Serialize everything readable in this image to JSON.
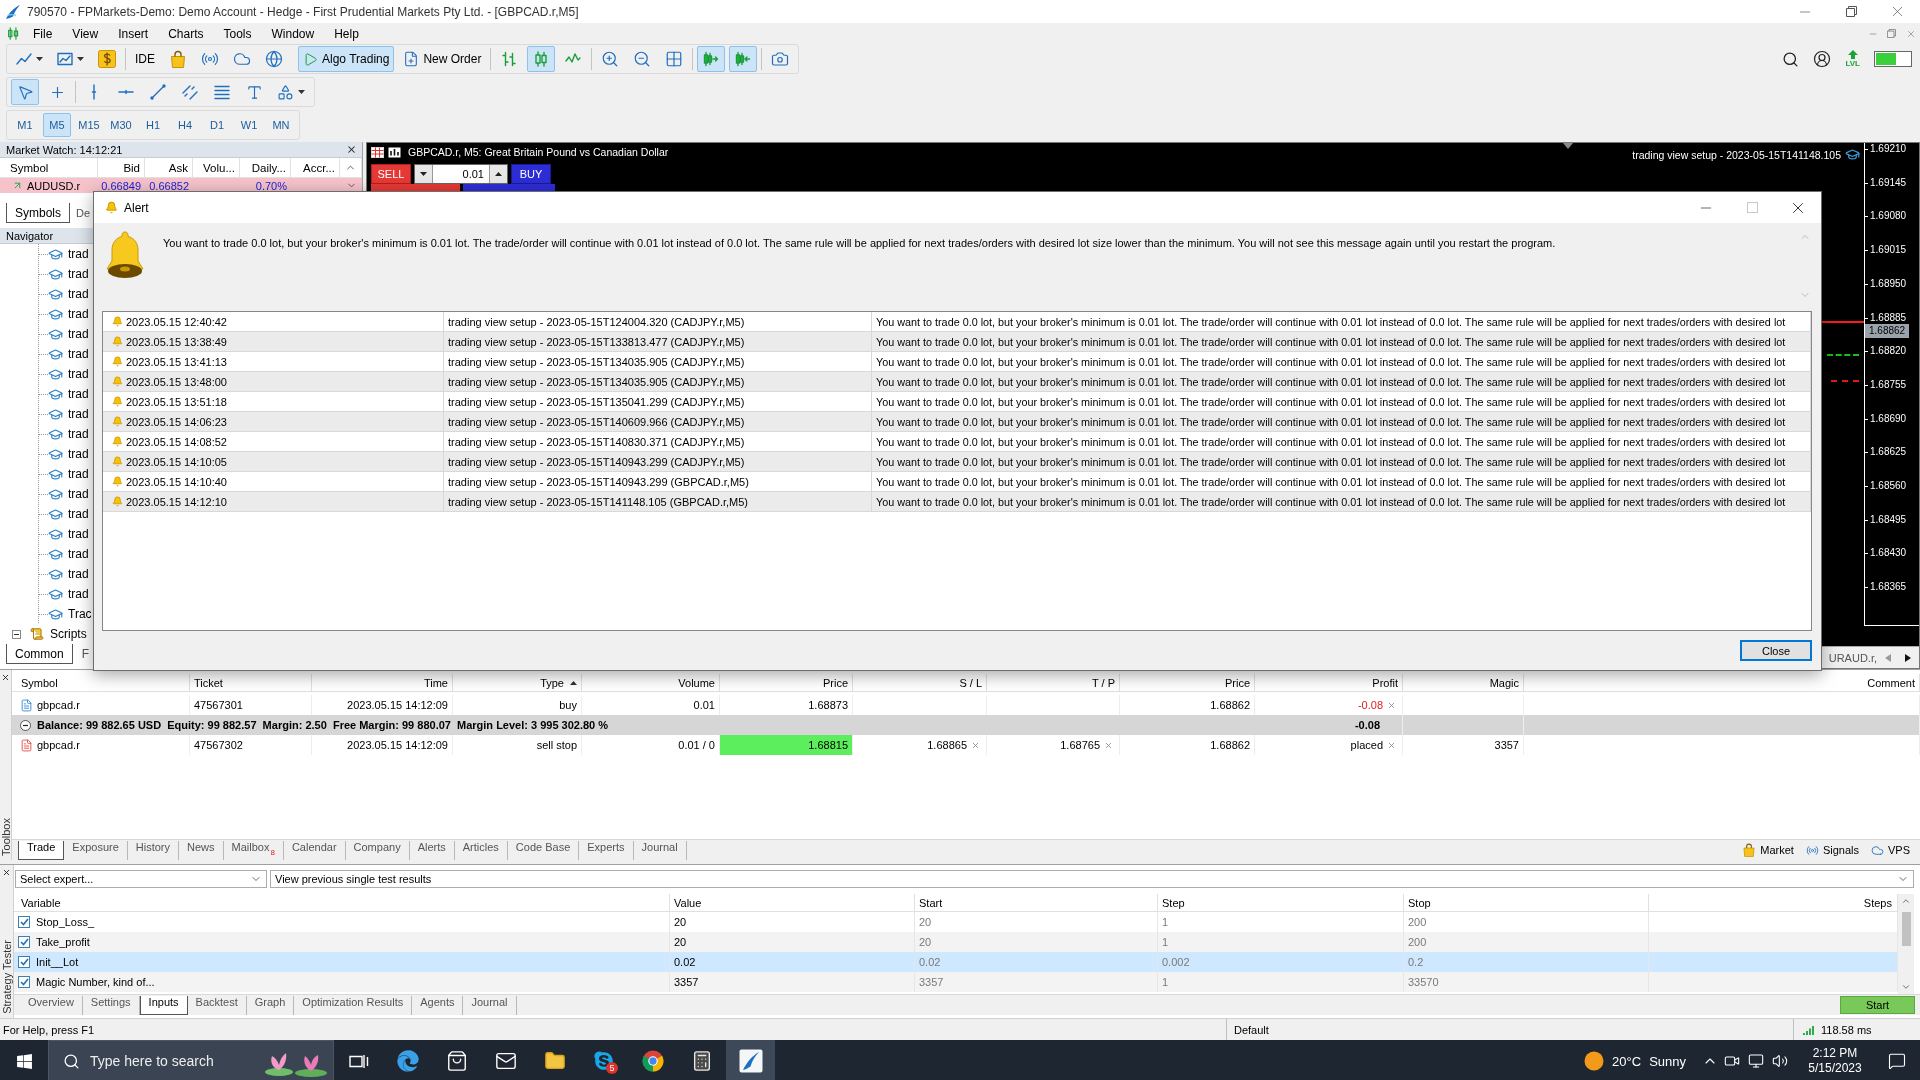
{
  "window": {
    "title": "790570 - FPMarkets-Demo: Demo Account - Hedge - First Prudential Markets Pty Ltd. - [GBPCAD.r,M5]"
  },
  "menu": [
    "File",
    "View",
    "Insert",
    "Charts",
    "Tools",
    "Window",
    "Help"
  ],
  "toolbar": [
    [
      {
        "on": false
      },
      {
        "on": false
      },
      {
        "on": false
      }
    ],
    [
      {
        "label": "IDE",
        "on": false
      },
      {
        "on": false
      },
      {
        "on": false
      },
      {
        "on": false
      },
      {
        "on": false
      }
    ],
    [
      {
        "label": "Algo Trading",
        "on": true
      },
      {
        "label": "New Order",
        "on": false
      }
    ],
    [
      {
        "on": false
      },
      {
        "on": true
      },
      {
        "on": false
      }
    ],
    [
      {
        "on": false
      },
      {
        "on": false
      },
      {
        "on": false
      }
    ],
    [
      {
        "on": true
      },
      {
        "on": true
      }
    ],
    [
      {
        "on": false
      }
    ]
  ],
  "status_badge": "LVL",
  "drawing_tools": [
    [
      {
        "on": true
      },
      {
        "on": false
      }
    ],
    [
      {
        "on": false
      },
      {
        "on": false
      },
      {
        "on": false
      },
      {
        "on": false
      },
      {
        "on": false
      },
      {
        "on": false
      },
      {
        "on": false
      }
    ]
  ],
  "timeframes": [
    {
      "label": "M1",
      "selected": false
    },
    {
      "label": "M5",
      "selected": true
    },
    {
      "label": "M15",
      "selected": false
    },
    {
      "label": "M30",
      "selected": false
    },
    {
      "label": "H1",
      "selected": false
    },
    {
      "label": "H4",
      "selected": false
    },
    {
      "label": "D1",
      "selected": false
    },
    {
      "label": "W1",
      "selected": false
    },
    {
      "label": "MN",
      "selected": false
    }
  ],
  "market_watch": {
    "title": "Market Watch: 14:12:21",
    "columns": [
      "Symbol",
      "Bid",
      "Ask",
      "Volu...",
      "Daily...",
      "Accr..."
    ],
    "rows": [
      {
        "symbol": "AUDUSD.r",
        "bid": "0.66849",
        "ask": "0.66852",
        "daily": "0.70%"
      }
    ],
    "tabs": [
      {
        "label": "Symbols",
        "selected": true
      },
      {
        "label": "De",
        "selected": false
      }
    ]
  },
  "navigator": {
    "title": "Navigator",
    "experts": [
      {
        "label": "trad"
      },
      {
        "label": "trad"
      },
      {
        "label": "trad"
      },
      {
        "label": "trad"
      },
      {
        "label": "trad"
      },
      {
        "label": "trad"
      },
      {
        "label": "trad"
      },
      {
        "label": "trad"
      },
      {
        "label": "trad"
      },
      {
        "label": "trad"
      },
      {
        "label": "trad"
      },
      {
        "label": "trad"
      },
      {
        "label": "trad"
      },
      {
        "label": "trad"
      },
      {
        "label": "trad"
      },
      {
        "label": "trad"
      },
      {
        "label": "trad"
      },
      {
        "label": "trad"
      },
      {
        "label": "Trac"
      }
    ],
    "folders": [
      {
        "label": "Scripts",
        "expanded": true
      }
    ],
    "tabs": [
      {
        "label": "Common",
        "selected": true
      },
      {
        "label": "F",
        "selected": false
      }
    ]
  },
  "chart": {
    "title": "GBPCAD.r, M5: Great Britain Pound vs Canadian Dollar",
    "sell": "SELL",
    "lot": "0.01",
    "buy": "BUY",
    "expert": "trading view setup - 2023-05-15T141148.105",
    "price_axis": [
      "1.69210",
      "1.69145",
      "1.69080",
      "1.69015",
      "1.68950",
      "1.68885",
      "1.68820",
      "1.68755",
      "1.68690",
      "1.68625",
      "1.68560",
      "1.68495",
      "1.68430",
      "1.68365"
    ],
    "current_price": "1.68862",
    "tab": "URAUD.r,"
  },
  "alert": {
    "title": "Alert",
    "message": "You want to trade 0.0 lot, but your broker's minimum is 0.01 lot. The trade/order will continue with 0.01 lot instead of 0.0 lot. The same rule will be applied for next trades/orders with desired lot size lower than the minimum. You will not see this message again until you restart the program.",
    "rows": [
      {
        "time": "2023.05.15 12:40:42",
        "source": "trading view setup - 2023-05-15T124004.320 (CADJPY.r,M5)",
        "message": "You want to trade 0.0 lot, but your broker's minimum is 0.01 lot. The trade/order will continue with 0.01 lot instead of 0.0 lot. The same rule will be applied for next trades/orders with desired lot"
      },
      {
        "time": "2023.05.15 13:38:49",
        "source": "trading view setup - 2023-05-15T133813.477 (CADJPY.r,M5)",
        "message": "You want to trade 0.0 lot, but your broker's minimum is 0.01 lot. The trade/order will continue with 0.01 lot instead of 0.0 lot. The same rule will be applied for next trades/orders with desired lot"
      },
      {
        "time": "2023.05.15 13:41:13",
        "source": "trading view setup - 2023-05-15T134035.905 (CADJPY.r,M5)",
        "message": "You want to trade 0.0 lot, but your broker's minimum is 0.01 lot. The trade/order will continue with 0.01 lot instead of 0.0 lot. The same rule will be applied for next trades/orders with desired lot"
      },
      {
        "time": "2023.05.15 13:48:00",
        "source": "trading view setup - 2023-05-15T134035.905 (CADJPY.r,M5)",
        "message": "You want to trade 0.0 lot, but your broker's minimum is 0.01 lot. The trade/order will continue with 0.01 lot instead of 0.0 lot. The same rule will be applied for next trades/orders with desired lot"
      },
      {
        "time": "2023.05.15 13:51:18",
        "source": "trading view setup - 2023-05-15T135041.299 (CADJPY.r,M5)",
        "message": "You want to trade 0.0 lot, but your broker's minimum is 0.01 lot. The trade/order will continue with 0.01 lot instead of 0.0 lot. The same rule will be applied for next trades/orders with desired lot"
      },
      {
        "time": "2023.05.15 14:06:23",
        "source": "trading view setup - 2023-05-15T140609.966 (CADJPY.r,M5)",
        "message": "You want to trade 0.0 lot, but your broker's minimum is 0.01 lot. The trade/order will continue with 0.01 lot instead of 0.0 lot. The same rule will be applied for next trades/orders with desired lot"
      },
      {
        "time": "2023.05.15 14:08:52",
        "source": "trading view setup - 2023-05-15T140830.371 (CADJPY.r,M5)",
        "message": "You want to trade 0.0 lot, but your broker's minimum is 0.01 lot. The trade/order will continue with 0.01 lot instead of 0.0 lot. The same rule will be applied for next trades/orders with desired lot"
      },
      {
        "time": "2023.05.15 14:10:05",
        "source": "trading view setup - 2023-05-15T140943.299 (CADJPY.r,M5)",
        "message": "You want to trade 0.0 lot, but your broker's minimum is 0.01 lot. The trade/order will continue with 0.01 lot instead of 0.0 lot. The same rule will be applied for next trades/orders with desired lot"
      },
      {
        "time": "2023.05.15 14:10:40",
        "source": "trading view setup - 2023-05-15T140943.299 (GBPCAD.r,M5)",
        "message": "You want to trade 0.0 lot, but your broker's minimum is 0.01 lot. The trade/order will continue with 0.01 lot instead of 0.0 lot. The same rule will be applied for next trades/orders with desired lot"
      },
      {
        "time": "2023.05.15 14:12:10",
        "source": "trading view setup - 2023-05-15T141148.105 (GBPCAD.r,M5)",
        "message": "You want to trade 0.0 lot, but your broker's minimum is 0.01 lot. The trade/order will continue with 0.01 lot instead of 0.0 lot. The same rule will be applied for next trades/orders with desired lot"
      }
    ],
    "button": "Close"
  },
  "trade": {
    "label": "Toolbox",
    "columns": [
      {
        "label": "Symbol",
        "sorted": false
      },
      {
        "label": "Ticket",
        "sorted": false
      },
      {
        "label": "Time",
        "sorted": false
      },
      {
        "label": "Type",
        "sorted": true
      },
      {
        "label": "Volume",
        "sorted": false
      },
      {
        "label": "Price",
        "sorted": false
      },
      {
        "label": "S / L",
        "sorted": false
      },
      {
        "label": "T / P",
        "sorted": false
      },
      {
        "label": "Price",
        "sorted": false
      },
      {
        "label": "Profit",
        "sorted": false
      },
      {
        "label": "Magic",
        "sorted": false
      },
      {
        "label": "Comment",
        "sorted": false
      }
    ],
    "rows": [
      {
        "kind": "position",
        "symbol": "gbpcad.r",
        "ticket": "47567301",
        "time": "2023.05.15 14:12:09",
        "type": "buy",
        "volume": "0.01",
        "price": "1.68873",
        "highlight": false,
        "current_price": "1.68862",
        "profit": "-0.08",
        "loss": true
      },
      {
        "kind": "summary",
        "expanded": true,
        "text": "Balance: 99 882.65 USD  Equity: 99 882.57  Margin: 2.50  Free Margin: 99 880.07  Margin Level: 3 995 302.80 %",
        "profit": "-0.08"
      },
      {
        "kind": "order",
        "symbol": "gbpcad.r",
        "ticket": "47567302",
        "time": "2023.05.15 14:12:09",
        "type": "sell stop",
        "volume": "0.01 / 0",
        "price": "1.68815",
        "highlight": true,
        "sl": "1.68865",
        "tp": "1.68765",
        "current_price": "1.68862",
        "profit": "placed",
        "loss": false,
        "magic": "3357"
      }
    ],
    "tabs": [
      {
        "label": "Trade",
        "selected": true
      },
      {
        "label": "Exposure",
        "selected": false
      },
      {
        "label": "History",
        "selected": false
      },
      {
        "label": "News",
        "selected": false
      },
      {
        "label": "Mailbox",
        "badge": "8",
        "selected": false
      },
      {
        "label": "Calendar",
        "selected": false
      },
      {
        "label": "Company",
        "selected": false
      },
      {
        "label": "Alerts",
        "selected": false
      },
      {
        "label": "Articles",
        "selected": false
      },
      {
        "label": "Code Base",
        "selected": false
      },
      {
        "label": "Experts",
        "selected": false
      },
      {
        "label": "Journal",
        "selected": false
      }
    ],
    "links": [
      "Market",
      "Signals",
      "VPS"
    ]
  },
  "tester": {
    "label": "Strategy Tester",
    "expert": "Select expert...",
    "results": "View previous single test results",
    "columns": [
      "Variable",
      "Value",
      "Start",
      "Step",
      "Stop",
      "Steps"
    ],
    "rows": [
      {
        "variable": "Stop_Loss_",
        "checked": true,
        "selected": false,
        "value": "20",
        "start": "20",
        "step": "1",
        "stop": "200"
      },
      {
        "variable": "Take_profit",
        "checked": true,
        "selected": false,
        "value": "20",
        "start": "20",
        "step": "1",
        "stop": "200"
      },
      {
        "variable": "Init__Lot",
        "checked": true,
        "selected": true,
        "value": "0.02",
        "start": "0.02",
        "step": "0.002",
        "stop": "0.2"
      },
      {
        "variable": "Magic Number, kind of...",
        "checked": true,
        "selected": false,
        "value": "3357",
        "start": "3357",
        "step": "1",
        "stop": "33570"
      }
    ],
    "tabs": [
      {
        "label": "Overview",
        "selected": false
      },
      {
        "label": "Settings",
        "selected": false
      },
      {
        "label": "Inputs",
        "selected": true
      },
      {
        "label": "Backtest",
        "selected": false
      },
      {
        "label": "Graph",
        "selected": false
      },
      {
        "label": "Optimization Results",
        "selected": false
      },
      {
        "label": "Agents",
        "selected": false
      },
      {
        "label": "Journal",
        "selected": false
      }
    ],
    "start": "Start"
  },
  "status_bar": {
    "help": "For Help, press F1",
    "profile": "Default",
    "ping": "118.58 ms"
  },
  "taskbar": {
    "search": {
      "placeholder": "Type here to search"
    },
    "apps": [
      {
        "active": false
      },
      {
        "active": false
      },
      {
        "active": false
      },
      {
        "active": false
      },
      {
        "active": false,
        "badge": "5"
      },
      {
        "active": false
      },
      {
        "active": false
      },
      {
        "active": true
      }
    ],
    "temperature": "20°C",
    "weather": "Sunny",
    "time": "2:12 PM",
    "date": "5/15/2023"
  }
}
